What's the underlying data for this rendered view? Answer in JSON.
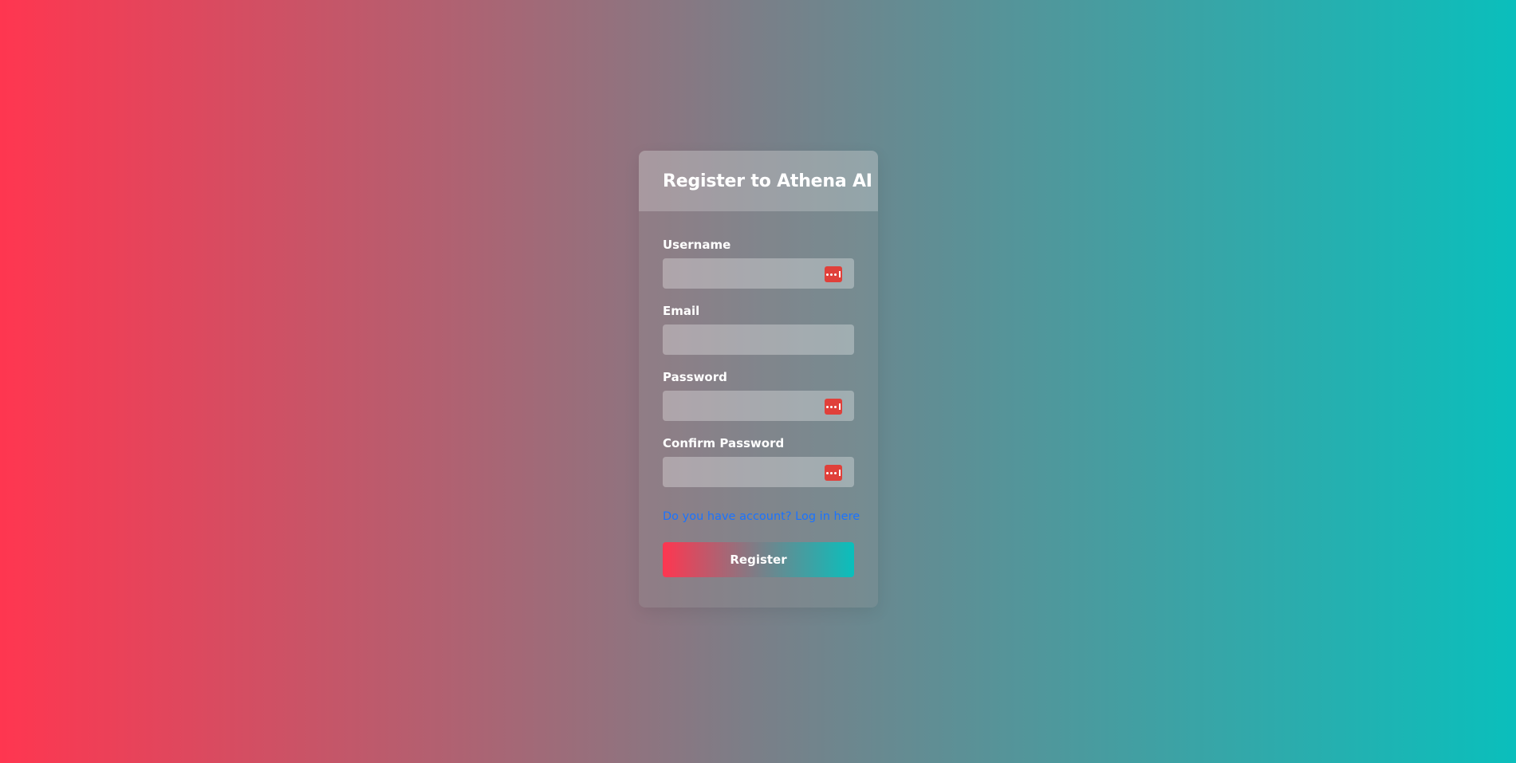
{
  "page": {
    "background_gradient": [
      "#ff3650",
      "#7a7f88",
      "#0abfbc"
    ]
  },
  "form": {
    "title": "Register to Athena AI",
    "fields": [
      {
        "label": "Username",
        "value": "",
        "type": "text",
        "icon": "password-manager-icon"
      },
      {
        "label": "Email",
        "value": "",
        "type": "email",
        "icon": null
      },
      {
        "label": "Password",
        "value": "",
        "type": "password",
        "icon": "password-manager-icon"
      },
      {
        "label": "Confirm Password",
        "value": "",
        "type": "password",
        "icon": "password-manager-icon"
      }
    ],
    "login_link": "Do you have account? Log in here",
    "submit_label": "Register",
    "link_color": "#1a73ff",
    "icon_color": "#e0403a"
  }
}
